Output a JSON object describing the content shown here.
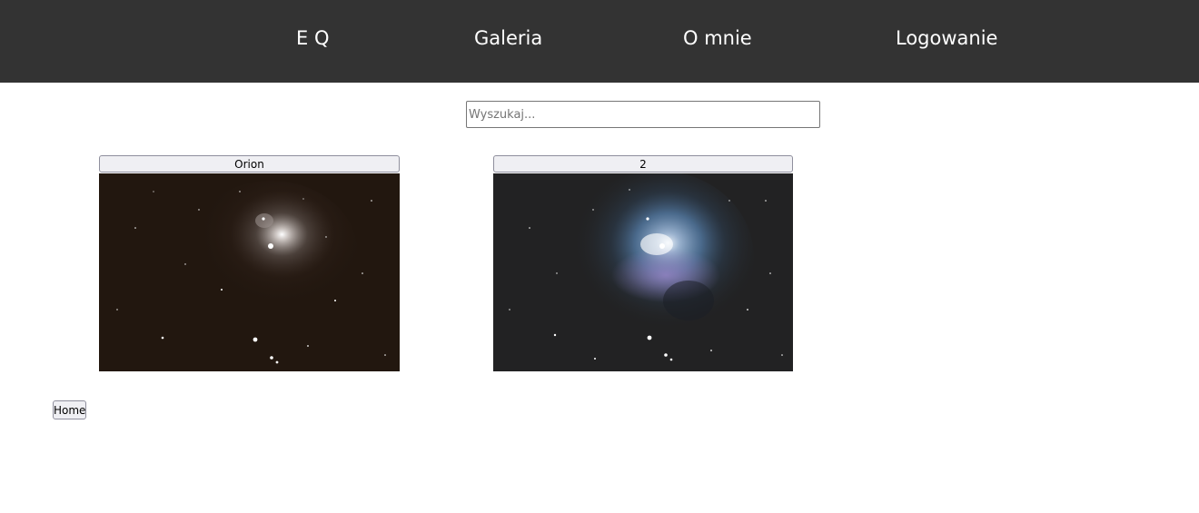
{
  "nav": {
    "items": [
      {
        "label": "E Q"
      },
      {
        "label": "Galeria"
      },
      {
        "label": "O mnie"
      },
      {
        "label": "Logowanie"
      }
    ]
  },
  "search": {
    "placeholder": "Wyszukaj...",
    "value": ""
  },
  "gallery": {
    "items": [
      {
        "label": "Orion",
        "image": "orion-nebula-photo-warm"
      },
      {
        "label": "2",
        "image": "orion-nebula-photo-blue"
      }
    ]
  },
  "footer": {
    "home_label": "Home"
  },
  "colors": {
    "nav_background": "#333333",
    "nav_text": "#ffffff",
    "page_background": "#ffffff"
  }
}
